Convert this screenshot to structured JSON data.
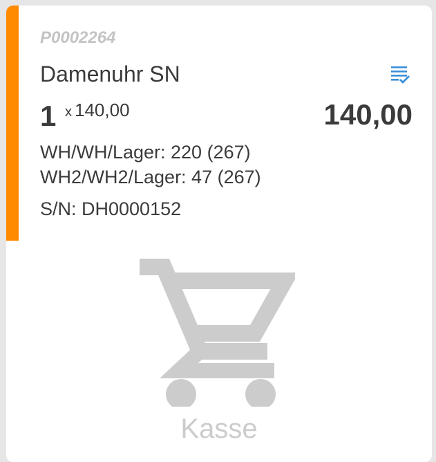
{
  "colors": {
    "accent": "#ff8a00",
    "icon_blue": "#3b8fd8",
    "muted": "#cccccc",
    "text": "#3b3b3b"
  },
  "line_item": {
    "sku": "P0002264",
    "name": "Damenuhr SN",
    "quantity": "1",
    "times_symbol": "x",
    "unit_price": "140,00",
    "total": "140,00",
    "stock": [
      "WH/WH/Lager: 220 (267)",
      "WH2/WH2/Lager: 47 (267)"
    ],
    "serial": "S/N: DH0000152",
    "details_icon": "list-check-icon"
  },
  "empty_state": {
    "icon": "shopping-cart-icon",
    "label": "Kasse"
  }
}
